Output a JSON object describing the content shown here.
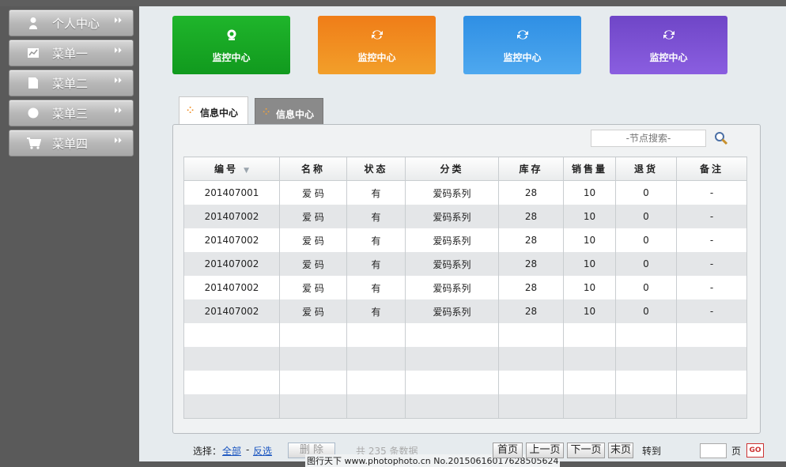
{
  "sidebar": {
    "items": [
      {
        "label": "个人中心",
        "icon": "person-icon"
      },
      {
        "label": "菜单一",
        "icon": "chart-icon"
      },
      {
        "label": "菜单二",
        "icon": "document-icon"
      },
      {
        "label": "菜单三",
        "icon": "circle-icon"
      },
      {
        "label": "菜单四",
        "icon": "cart-icon"
      }
    ],
    "arrow_glyph": "⏵⏵"
  },
  "tiles": [
    {
      "label": "监控中心",
      "icon": "monitor-icon",
      "color": "#1aae26"
    },
    {
      "label": "监控中心",
      "icon": "refresh-icon",
      "color": "#f28a20"
    },
    {
      "label": "监控中心",
      "icon": "refresh-icon",
      "color": "#3b9be9"
    },
    {
      "label": "监控中心",
      "icon": "refresh-icon",
      "color": "#7b52d4"
    }
  ],
  "tabs": [
    {
      "label": "信息中心",
      "active": true
    },
    {
      "label": "信息中心",
      "active": false
    }
  ],
  "search": {
    "placeholder": "-节点搜索-"
  },
  "table": {
    "columns": [
      "编号",
      "名称",
      "状态",
      "分类",
      "库存",
      "销售量",
      "退货",
      "备注"
    ],
    "rows": [
      [
        "201407001",
        "爱 码",
        "有",
        "爱码系列",
        "28",
        "10",
        "0",
        "-"
      ],
      [
        "201407002",
        "爱 码",
        "有",
        "爱码系列",
        "28",
        "10",
        "0",
        "-"
      ],
      [
        "201407002",
        "爱 码",
        "有",
        "爱码系列",
        "28",
        "10",
        "0",
        "-"
      ],
      [
        "201407002",
        "爱 码",
        "有",
        "爱码系列",
        "28",
        "10",
        "0",
        "-"
      ],
      [
        "201407002",
        "爱 码",
        "有",
        "爱码系列",
        "28",
        "10",
        "0",
        "-"
      ],
      [
        "201407002",
        "爱 码",
        "有",
        "爱码系列",
        "28",
        "10",
        "0",
        "-"
      ]
    ],
    "empty_rows": 4
  },
  "footer": {
    "select_label": "选择：",
    "select_all": "全部",
    "separator": "-",
    "invert": "反选",
    "delete": "删 除",
    "total_text": "共 235 条数据",
    "first_page": "首页",
    "prev_page": "上一页",
    "next_page": "下一页",
    "last_page": "末页",
    "goto_label": "转到",
    "page_unit": "页",
    "go": "GO",
    "watermark": "图行天下 www.photophoto.cn No.20150616017628505624"
  }
}
